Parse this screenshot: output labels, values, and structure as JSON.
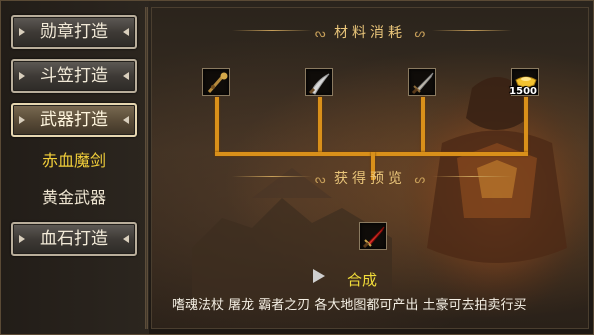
{
  "sidebar": {
    "items": [
      {
        "label": "勋章打造"
      },
      {
        "label": "斗笠打造"
      },
      {
        "label": "武器打造",
        "active": true
      },
      {
        "label": "血石打造"
      }
    ],
    "subitems": [
      {
        "label": "赤血魔剑",
        "selected": true
      },
      {
        "label": "黄金武器"
      }
    ]
  },
  "main": {
    "materials_title": "材料消耗",
    "preview_title": "获得预览",
    "materials": [
      {
        "icon": "staff-icon"
      },
      {
        "icon": "curved-blade-icon"
      },
      {
        "icon": "sword-icon"
      },
      {
        "icon": "gold-ingot-icon",
        "quantity": "1500"
      }
    ],
    "result": {
      "icon": "red-sword-icon"
    },
    "combine_label": "合成",
    "description": "嗜魂法杖 屠龙 霸者之刃 各大地图都可产出 土豪可去拍卖行买"
  },
  "colors": {
    "pipe": "#d9901a",
    "highlight": "#f2cf3a",
    "title": "#e9c57a"
  }
}
